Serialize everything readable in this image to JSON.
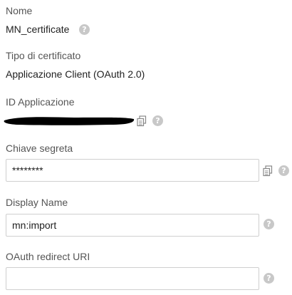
{
  "fields": {
    "nome": {
      "label": "Nome",
      "value": "MN_certificate"
    },
    "tipo_certificato": {
      "label": "Tipo di certificato",
      "value": "Applicazione Client (OAuth 2.0)"
    },
    "id_applicazione": {
      "label": "ID Applicazione",
      "value_redacted": true
    },
    "chiave_segreta": {
      "label": "Chiave segreta",
      "value": "********"
    },
    "display_name": {
      "label": "Display Name",
      "value": "mn:import"
    },
    "oauth_redirect_uri": {
      "label": "OAuth redirect URI",
      "value": ""
    }
  },
  "icons": {
    "help": "help-question-icon",
    "copy": "copy-icon"
  },
  "glyphs": {
    "help": "?"
  },
  "colors": {
    "label": "#555555",
    "value": "#1f1f1f",
    "help_icon": "#c8c8c8",
    "input_border": "#cfcfcf",
    "redaction": "#000000"
  }
}
